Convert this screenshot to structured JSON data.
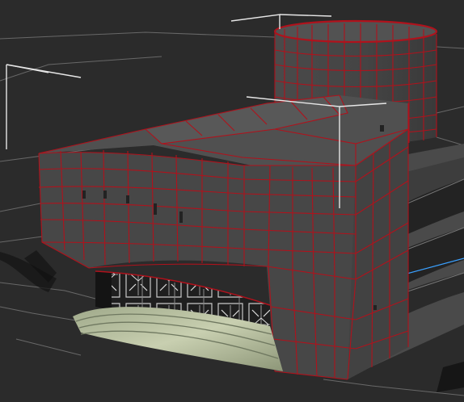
{
  "viewport": {
    "mode": "perspective",
    "shading": "wireframe-on-shaded",
    "background_color": "#2b2b2b",
    "grid_color": "#6a6a6a",
    "wire_color": "#b0121c",
    "selection_bracket_color": "#e6e6e6",
    "axis_color": "#3aa0ff"
  },
  "model": {
    "object": "building",
    "selected": true,
    "parts": [
      "facade",
      "roof",
      "cylinder-tower",
      "entrance-doors",
      "entrance-steps",
      "side-parking-openings"
    ]
  }
}
